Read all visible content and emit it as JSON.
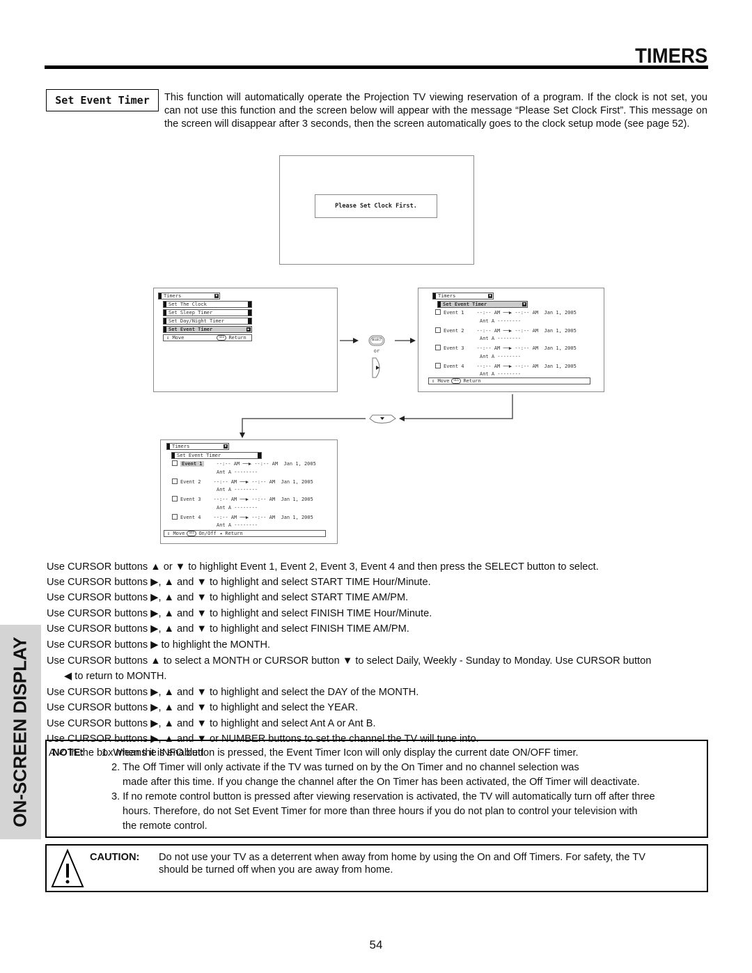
{
  "header": {
    "title": "TIMERS"
  },
  "section": {
    "label": "Set Event Timer",
    "intro": "This function will automatically operate the Projection TV viewing reservation of a program.  If the clock is not set, you can not use this function and the screen below will appear with the message “Please Set Clock First”.  This message on the screen will disappear after 3 seconds, then the screen automatically goes to the clock setup mode (see page 52)."
  },
  "screen_message": {
    "text": "Please Set Clock First."
  },
  "timers_menu": {
    "title": "Timers",
    "items": [
      {
        "label": "Set The Clock",
        "highlighted": false
      },
      {
        "label": "Set Sleep Timer",
        "highlighted": false
      },
      {
        "label": "Set Day/Night Timer",
        "highlighted": false
      },
      {
        "label": "Set Event Timer",
        "highlighted": true
      }
    ],
    "footer": {
      "move": "Move",
      "sel": "SEL",
      "return": "Return"
    }
  },
  "remote": {
    "select_label": "SELECT",
    "or_label": "or"
  },
  "event_menu": {
    "title": "Timers",
    "subtitle": "Set Event Timer",
    "events": [
      {
        "label": "Event 1",
        "start": "--:-- AM",
        "finish": "--:-- AM",
        "date": "Jan 1, 2005",
        "ant": "Ant A",
        "channel": "--------"
      },
      {
        "label": "Event 2",
        "start": "--:-- AM",
        "finish": "--:-- AM",
        "date": "Jan 1, 2005",
        "ant": "Ant A",
        "channel": "--------"
      },
      {
        "label": "Event 3",
        "start": "--:-- AM",
        "finish": "--:-- AM",
        "date": "Jan 1, 2005",
        "ant": "Ant A",
        "channel": "--------"
      },
      {
        "label": "Event 4",
        "start": "--:-- AM",
        "finish": "--:-- AM",
        "date": "Jan 1, 2005",
        "ant": "Ant A",
        "channel": "--------"
      }
    ],
    "footer": {
      "move": "Move",
      "sel": "SEL",
      "return": "Return"
    },
    "footer_onoff": {
      "move": "Move",
      "sel": "SEL",
      "onoff": "On/Off",
      "return": "Return"
    }
  },
  "instructions": [
    "Use CURSOR buttons ▲ or ▼ to highlight Event 1, Event 2, Event 3, Event 4 and then press the SELECT button to select.",
    "Use CURSOR buttons ▶, ▲ and ▼ to highlight and select START TIME Hour/Minute.",
    "Use CURSOR buttons ▶, ▲ and ▼ to highlight and select START TIME AM/PM.",
    "Use CURSOR buttons ▶, ▲ and ▼ to highlight and select FINISH TIME Hour/Minute.",
    "Use CURSOR buttons ▶, ▲ and ▼ to highlight and select FINISH TIME AM/PM.",
    "Use CURSOR buttons ▶ to highlight the MONTH.",
    "Use CURSOR buttons ▲ to select a MONTH or CURSOR button ▼ to select Daily, Weekly - Sunday to Monday.  Use CURSOR button",
    "◀ to return to MONTH.",
    "Use CURSOR buttons ▶, ▲ and ▼ to highlight and select the DAY of the MONTH.",
    "Use CURSOR buttons ▶, ▲ and ▼ to highlight and select the YEAR.",
    "Use CURSOR buttons ▶, ▲ and ▼ to highlight and select Ant A or Ant B.",
    "Use CURSOR buttons ▶, ▲ and ▼ or NUMBER buttons to set the channel the TV will tune into."
  ],
  "side_tab": {
    "label": "ON-SCREEN DISPLAY"
  },
  "note": {
    "label": "NOTE:",
    "overlay_text": "A ✓ in the box means it is enabled.",
    "items": [
      "1. When the INFO button is pressed, the Event Timer Icon will only display the current date ON/OFF timer.",
      "2. The Off Timer will only activate if the TV was turned on by the On Timer and no channel selection was",
      "made after this time.  If you change the channel after the On Timer has been activated, the Off Timer will deactivate.",
      "3. If no remote control button is pressed after viewing reservation is activated, the TV will automatically turn off after three",
      "hours.  Therefore, do not Set Event Timer for more than three hours if you do not plan to control your television with",
      "the remote control."
    ]
  },
  "caution": {
    "label": "CAUTION:",
    "text_line1": "Do not use your TV as a deterrent when away from home by using the On and Off Timers.  For safety, the TV",
    "text_line2": "should be turned off when you are away from home."
  },
  "page_number": "54"
}
